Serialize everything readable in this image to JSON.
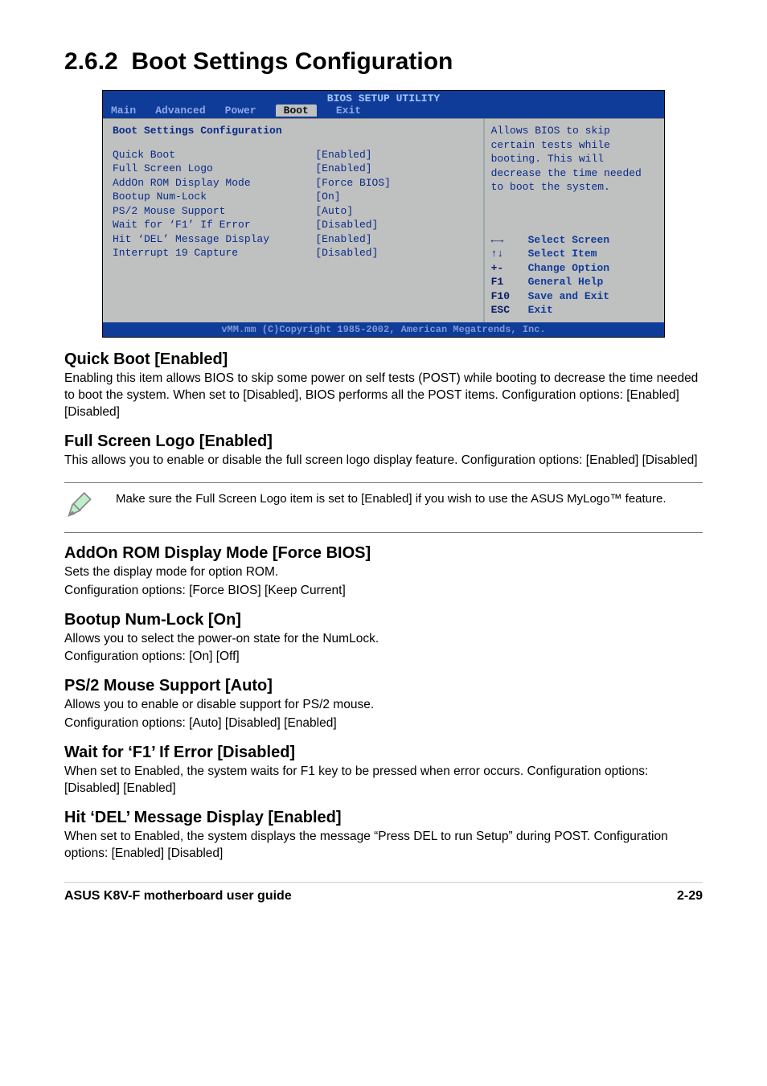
{
  "section": {
    "number": "2.6.2",
    "title": "Boot Settings Configuration"
  },
  "bios": {
    "utility_title": "BIOS SETUP UTILITY",
    "menu": {
      "main": "Main",
      "advanced": "Advanced",
      "power": "Power",
      "boot": "Boot",
      "exit": "Exit"
    },
    "panel_title": "Boot Settings Configuration",
    "rows": [
      {
        "label": "Quick Boot",
        "value": "[Enabled]"
      },
      {
        "label": "Full Screen Logo",
        "value": "[Enabled]"
      },
      {
        "label": "AddOn ROM Display Mode",
        "value": "[Force BIOS]"
      },
      {
        "label": "Bootup Num-Lock",
        "value": "[On]"
      },
      {
        "label": "PS/2 Mouse Support",
        "value": "[Auto]"
      },
      {
        "label": "Wait for ‘F1’ If Error",
        "value": "[Disabled]"
      },
      {
        "label": "Hit ‘DEL’ Message Display",
        "value": "[Enabled]"
      },
      {
        "label": "Interrupt 19 Capture",
        "value": "[Disabled]"
      }
    ],
    "help": "Allows BIOS to skip certain tests while booting. This will decrease the time needed to boot the system.",
    "keys": [
      {
        "k": "←→",
        "d": "Select Screen"
      },
      {
        "k": "↑↓",
        "d": "Select Item"
      },
      {
        "k": "+-",
        "d": "Change Option"
      },
      {
        "k": "F1",
        "d": "General Help"
      },
      {
        "k": "F10",
        "d": "Save and Exit"
      },
      {
        "k": "ESC",
        "d": "Exit"
      }
    ],
    "footer": "vMM.mm (C)Copyright 1985-2002, American Megatrends, Inc."
  },
  "items": {
    "quick_boot": {
      "title": "Quick Boot [Enabled]",
      "body": "Enabling this item allows BIOS to skip some power on self tests (POST) while booting to decrease the time needed to boot the system. When set to [Disabled], BIOS performs all the POST items. Configuration options: [Enabled] [Disabled]"
    },
    "full_screen_logo": {
      "title": "Full Screen Logo [Enabled]",
      "body": "This allows you to enable or disable the full screen logo display feature. Configuration options: [Enabled] [Disabled]"
    },
    "note_text": "Make sure the Full Screen Logo item is set to [Enabled] if you wish to use the ASUS MyLogo™ feature.",
    "addon_rom": {
      "title": "AddOn ROM Display Mode [Force BIOS]",
      "body1": "Sets the display mode for option ROM.",
      "body2": "Configuration options: [Force BIOS] [Keep Current]"
    },
    "numlock": {
      "title": "Bootup Num-Lock [On]",
      "body1": "Allows you to select the power-on state for the NumLock.",
      "body2": "Configuration options: [On] [Off]"
    },
    "ps2": {
      "title": "PS/2 Mouse Support [Auto]",
      "body1": "Allows you to enable or disable support for PS/2 mouse.",
      "body2": "Configuration options: [Auto] [Disabled] [Enabled]"
    },
    "wait_f1": {
      "title": "Wait for ‘F1’ If Error [Disabled]",
      "body": "When set to Enabled, the system waits for F1 key to be pressed when error occurs. Configuration options: [Disabled] [Enabled]"
    },
    "hit_del": {
      "title": "Hit ‘DEL’ Message Display [Enabled]",
      "body": "When set to Enabled, the system displays the message “Press DEL to run Setup” during POST. Configuration options: [Enabled] [Disabled]"
    }
  },
  "footer": {
    "left": "ASUS K8V-F motherboard user guide",
    "right": "2-29"
  }
}
